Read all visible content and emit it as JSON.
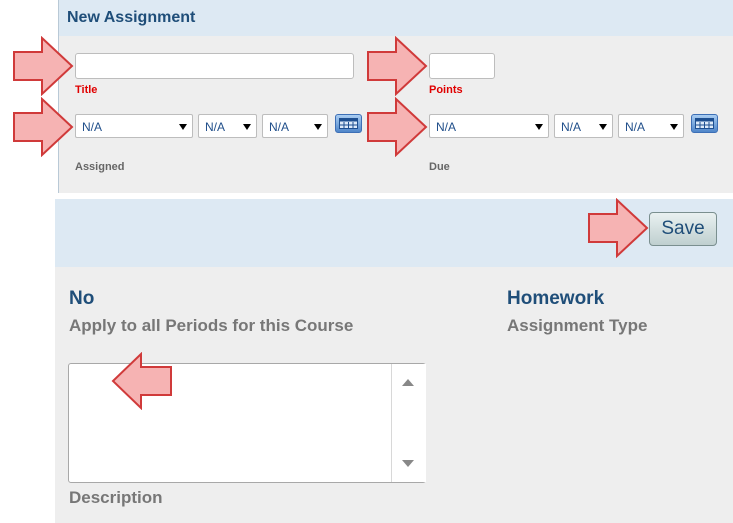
{
  "panel": {
    "title": "New Assignment"
  },
  "fields": {
    "title": {
      "label": "Title",
      "value": ""
    },
    "points": {
      "label": "Points",
      "value": ""
    }
  },
  "assigned": {
    "label": "Assigned",
    "date_select": "N/A",
    "hour_select": "N/A",
    "minute_select": "N/A"
  },
  "due": {
    "label": "Due",
    "date_select": "N/A",
    "hour_select": "N/A",
    "minute_select": "N/A"
  },
  "actions": {
    "save_label": "Save"
  },
  "apply_periods": {
    "value": "No",
    "caption": "Apply to all Periods for this Course"
  },
  "assignment_type": {
    "value": "Homework",
    "caption": "Assignment Type"
  },
  "description": {
    "label": "Description",
    "value": ""
  },
  "colors": {
    "header_bg": "#dde9f3",
    "panel_bg": "#eeeeee",
    "title_blue": "#1f4e79",
    "required_red": "#e00000",
    "callout_fill": "#f6b3b3",
    "callout_stroke": "#d03a3a"
  },
  "icons": {
    "calendar": "calendar-icon",
    "callout": "arrow-callout-icon"
  }
}
